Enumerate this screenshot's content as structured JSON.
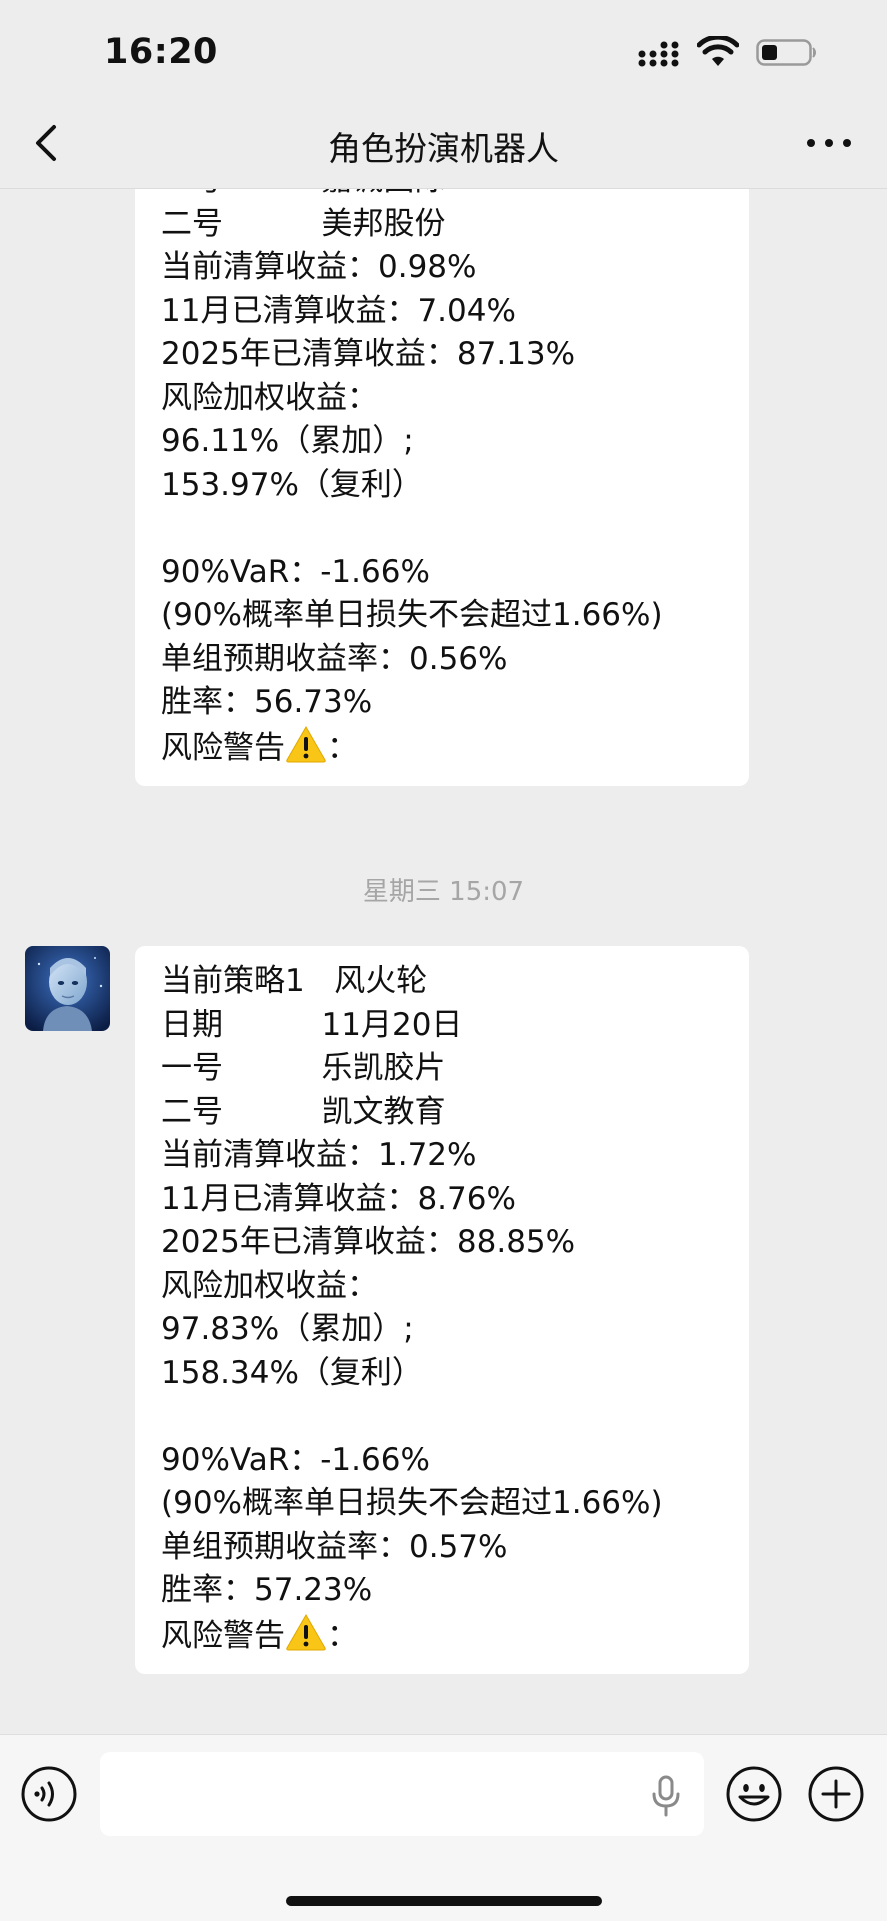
{
  "status_bar": {
    "time": "16:20"
  },
  "nav": {
    "title": "角色扮演机器人"
  },
  "messages_top": [
    "一号          嘉诚国际",
    "二号          美邦股份",
    "当前清算收益：0.98%",
    "11月已清算收益：7.04%",
    "2025年已清算收益：87.13%",
    "风险加权收益：",
    "96.11%（累加）;",
    "153.97%（复利）",
    "",
    "90%VaR：-1.66%",
    "(90%概率单日损失不会超过1.66%)",
    "单组预期收益率：0.56%",
    "胜率：56.73%",
    "风险警告"
  ],
  "timestamp": "星期三 15:07",
  "messages_bottom": [
    "当前策略1   风火轮",
    "日期          11月20日",
    "一号          乐凯胶片",
    "二号          凯文教育",
    "当前清算收益：1.72%",
    "11月已清算收益：8.76%",
    "2025年已清算收益：88.85%",
    "风险加权收益：",
    "97.83%（累加）;",
    "158.34%（复利）",
    "",
    "90%VaR：-1.66%",
    "(90%概率单日损失不会超过1.66%)",
    "单组预期收益率：0.57%",
    "胜率：57.23%",
    "风险警告"
  ],
  "warning_suffix": "：",
  "input": {
    "placeholder": ""
  },
  "icons": {
    "back": "chevron-left-icon",
    "more": "more-dots-icon",
    "voice": "voice-icon",
    "mic": "microphone-icon",
    "emoji": "emoji-icon",
    "plus": "plus-icon",
    "warning": "warning-emoji"
  },
  "colors": {
    "background": "#ededed",
    "bubble": "#ffffff",
    "timestamp": "#a6a6a6",
    "warning": "#f9c516"
  }
}
